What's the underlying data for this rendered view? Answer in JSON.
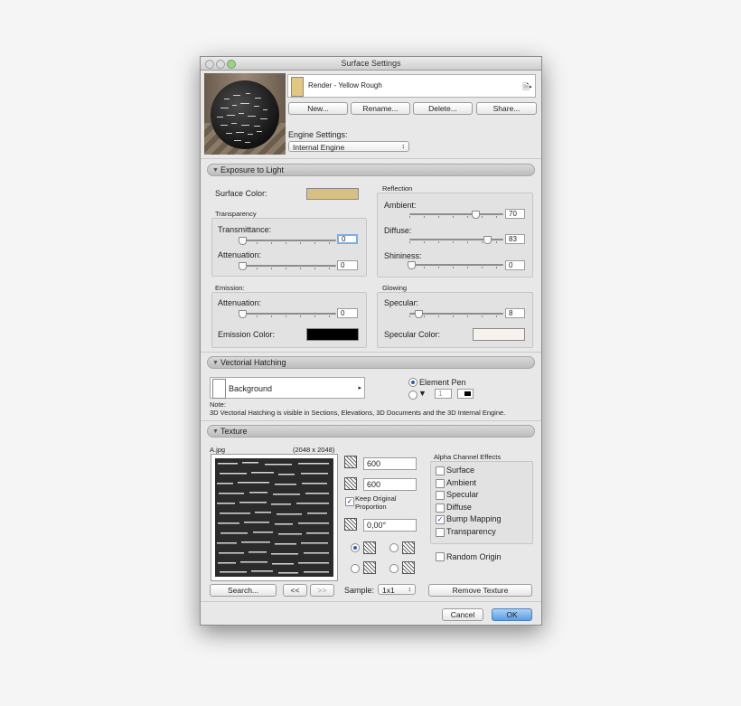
{
  "window": {
    "title": "Surface Settings"
  },
  "header": {
    "material_name": "Render - Yellow Rough",
    "material_color": "#e2c783",
    "buttons": {
      "new": "New...",
      "rename": "Rename...",
      "delete": "Delete...",
      "share": "Share..."
    },
    "engine_label": "Engine Settings:",
    "engine_value": "Internal Engine"
  },
  "exposure": {
    "section_title": "Exposure to Light",
    "surface_color_label": "Surface Color:",
    "surface_color": "#d7c084",
    "transparency": {
      "group_label": "Transparency",
      "transmittance_label": "Transmittance:",
      "transmittance_value": "0",
      "attenuation_label": "Attenuation:",
      "attenuation_value": "0"
    },
    "reflection": {
      "group_label": "Reflection",
      "ambient_label": "Ambient:",
      "ambient_value": "70",
      "diffuse_label": "Diffuse:",
      "diffuse_value": "83",
      "shininess_label": "Shininess:",
      "shininess_value": "0"
    },
    "emission": {
      "group_label": "Emission:",
      "attenuation_label": "Attenuation:",
      "attenuation_value": "0",
      "color_label": "Emission Color:",
      "color": "#000000"
    },
    "glowing": {
      "group_label": "Glowing",
      "specular_label": "Specular:",
      "specular_value": "8",
      "color_label": "Specular Color:",
      "color": "#f7f3ec"
    }
  },
  "hatching": {
    "section_title": "Vectorial Hatching",
    "fill_value": "Background",
    "element_pen_label": "Element Pen",
    "pen_number": "1",
    "note_label": "Note:",
    "note_text": "3D Vectorial Hatching is visible in Sections, Elevations, 3D Documents and the 3D Internal Engine."
  },
  "texture": {
    "section_title": "Texture",
    "file_name": "A.jpg",
    "file_size": "(2048 x 2048)",
    "width_value": "600",
    "height_value": "600",
    "keep_proportion_label": "Keep Original Proportion",
    "angle_value": "0,00°",
    "alpha_title": "Alpha Channel Effects",
    "alpha_options": [
      {
        "label": "Surface",
        "checked": false
      },
      {
        "label": "Ambient",
        "checked": false
      },
      {
        "label": "Specular",
        "checked": false
      },
      {
        "label": "Diffuse",
        "checked": false
      },
      {
        "label": "Bump Mapping",
        "checked": true
      },
      {
        "label": "Transparency",
        "checked": false
      }
    ],
    "random_origin_label": "Random Origin",
    "search_button": "Search...",
    "prev_button": "<<",
    "next_button": ">>",
    "sample_label": "Sample:",
    "sample_value": "1x1",
    "remove_button": "Remove Texture"
  },
  "footer": {
    "cancel": "Cancel",
    "ok": "OK"
  }
}
